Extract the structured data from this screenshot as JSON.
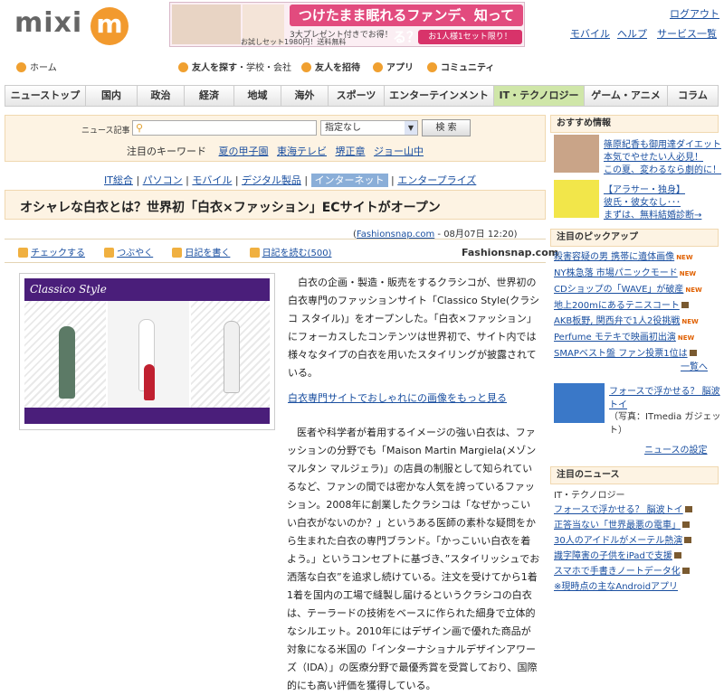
{
  "header": {
    "logo": "mixi",
    "logo_mark": "m",
    "logout": "ログアウト",
    "links": [
      "モバイル",
      "ヘルプ",
      "サービス一覧"
    ]
  },
  "banner": {
    "headline": "つけたまま眠れるファンデ、知ってる？",
    "sub": "3大プレゼント付きでお得！",
    "offer": "お試しセット1980円！送料無料",
    "button": "お1人様1セット限り！",
    "brand": "ONLY MINERALS"
  },
  "nav": {
    "home": "ホーム",
    "find": "友人を探す",
    "find_sub": "・学校・会社",
    "invite": "友人を招待",
    "apps": "アプリ",
    "community": "コミュニティ"
  },
  "tabs": [
    "ニューストップ",
    "国内",
    "政治",
    "経済",
    "地域",
    "海外",
    "スポーツ",
    "エンターテインメント",
    "IT・テクノロジー",
    "ゲーム・アニメ",
    "コラム"
  ],
  "search": {
    "label": "ニュース記事",
    "select": "指定なし",
    "button": "検 索",
    "kw_label": "注目のキーワード",
    "keywords": [
      "夏の甲子園",
      "東海テレビ",
      "堺正章",
      "ジョー山中"
    ]
  },
  "cats": [
    "IT総合",
    "パソコン",
    "モバイル",
    "デジタル製品",
    "インターネット",
    "エンタープライズ"
  ],
  "article": {
    "title": "オシャレな白衣とは？世界初「白衣×ファッション」ECサイトがオープン",
    "source": "Fashionsnap.com",
    "date": "- 08月07日 12:20)",
    "check": "チェックする",
    "tweet": "つぶやく",
    "diary": "日記を書く",
    "read": "日記を読む(500)",
    "logo": "Fashionsnap.com",
    "photo_title": "Classico Style",
    "p1": "白衣の企画・製造・販売をするクラシコが、世界初の白衣専門のファッションサイト「Classico Style(クラシコ スタイル)」をオープンした。「白衣×ファッション」にフォーカスしたコンテンツは世界初で、サイト内では様々なタイプの白衣を用いたスタイリングが披露されている。",
    "more": "白衣専門サイトでおしゃれにの画像をもっと見る",
    "p2": "医者や科学者が着用するイメージの強い白衣は、ファッションの分野でも「Maison Martin Margiela(メゾン マルタン マルジェラ)」の店員の制服として知られているなど、ファンの間では密かな人気を誇っているファッション。2008年に創業したクラシコは「なぜかっこいい白衣がないのか？」というある医師の素朴な疑問をから生まれた白衣の専門ブランド。「かっこいい白衣を着よう。」というコンセプトに基づき、”スタイリッシュでお洒落な白衣”を追求し続けている。注文を受けてから1着1着を国内の工場で縫製し届けるというクラシコの白衣は、テーラードの技術をベースに作られた細身で立体的なシルエット。2010年にはデザイン画で優れた商品が対象になる米国の「インターナショナルデザインアワーズ（IDA）」の医療分野で最優秀賞を受賞しており、国際的にも高い評価を獲得している。"
  },
  "sidebar": {
    "rec_title": "おすすめ情報",
    "rec1": [
      "篠原紀香も御用達ダイエット",
      "本気でやせたい人必見！",
      "この夏、変わるなら劇的に！"
    ],
    "rec2": [
      "【アラサー・独身】",
      "彼氏・彼女なし･･･",
      "まずは、無料結婚診断→"
    ],
    "pick_title": "注目のピックアップ",
    "picks": [
      "殺害容疑の男 携帯に遺体画像",
      "NY株急落 市場パニックモード",
      "CDショップの「WAVE」が破産",
      "地上200mにあるテニスコート",
      "AKB板野, 関西弁で1人2役挑戦",
      "Perfume モテキで映画初出演",
      "SMAPベスト盤 ファン投票1位は"
    ],
    "more": "一覧へ",
    "it": [
      "フォースで浮かせる？ 脳波トイ",
      "（写真：ITmedia ガジェット）"
    ],
    "settings": "ニュースの設定",
    "news_title": "注目のニュース",
    "news_cat": "IT・テクノロジー",
    "news": [
      "フォースで浮かせる？ 脳波トイ",
      "正答当ない「世界最悪の電車」",
      "30人のアイドルがメーテル熱演",
      "識字障害の子供をiPadで支援",
      "スマホで手書きノートデータ化",
      "※現時点の主なAndroidアプリ"
    ]
  }
}
